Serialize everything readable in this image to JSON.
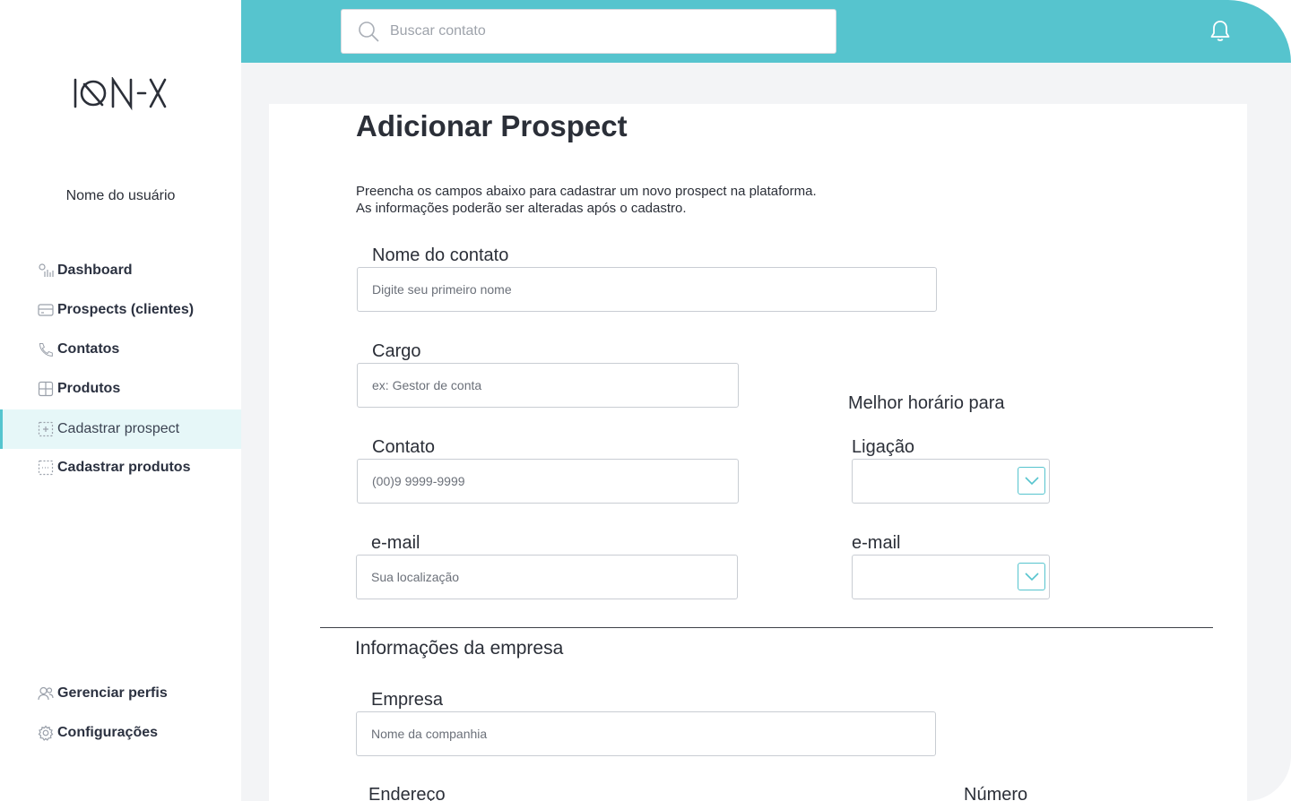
{
  "sidebar": {
    "logo": "ION-X",
    "username": "Nome do usuário",
    "items": [
      {
        "label": "Dashboard",
        "icon": "dashboard-icon"
      },
      {
        "label": "Prospects (clientes)",
        "icon": "card-icon"
      },
      {
        "label": "Contatos",
        "icon": "phone-icon"
      },
      {
        "label": "Produtos",
        "icon": "grid-icon"
      },
      {
        "label": "Cadastrar prospect",
        "icon": "add-frame-icon",
        "active": true
      },
      {
        "label": "Cadastrar produtos",
        "icon": "scan-frame-icon"
      }
    ],
    "bottom_items": [
      {
        "label": "Gerenciar perfis",
        "icon": "users-icon"
      },
      {
        "label": "Configurações",
        "icon": "gear-icon"
      }
    ]
  },
  "topbar": {
    "search_placeholder": "Buscar contato"
  },
  "page": {
    "title": "Adicionar Prospect",
    "description_line1": "Preencha os campos abaixo para cadastrar um novo prospect na plataforma.",
    "description_line2": "As informações poderão ser alteradas após o cadastro."
  },
  "form": {
    "nome": {
      "label": "Nome do contato",
      "placeholder": "Digite seu primeiro nome"
    },
    "cargo": {
      "label": "Cargo",
      "placeholder": "ex: Gestor de conta"
    },
    "contato": {
      "label": "Contato",
      "placeholder": "(00)9 9999-9999"
    },
    "email": {
      "label": "e-mail",
      "placeholder": "Sua localização"
    },
    "melhor_horario": {
      "title": "Melhor horário para",
      "ligacao_label": "Ligação",
      "email_label": "e-mail"
    }
  },
  "empresa_section": {
    "title": "Informações da empresa",
    "empresa": {
      "label": "Empresa",
      "placeholder": "Nome da companhia"
    },
    "endereco_label": "Endereço",
    "numero_label": "Número"
  },
  "colors": {
    "accent": "#56c4ce",
    "background": "#f3f4f6",
    "active_bg": "#e6f7f8"
  }
}
